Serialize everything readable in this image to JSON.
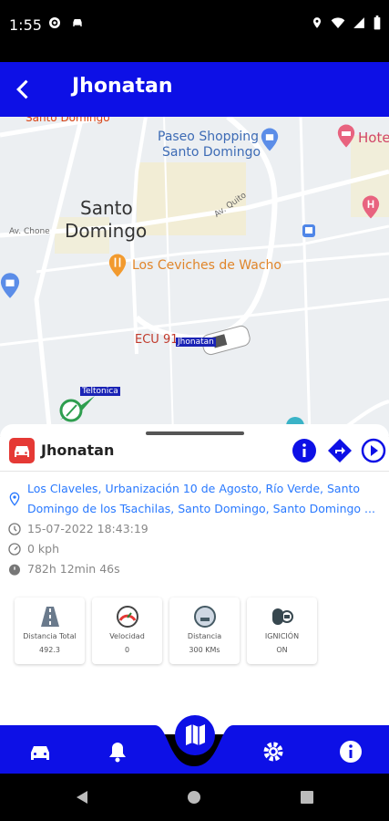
{
  "status_bar": {
    "time": "1:55"
  },
  "app_bar": {
    "title": "Jhonatan"
  },
  "map": {
    "labels": {
      "santo_domingo_top": "Santo Domingo",
      "paseo": "Paseo Shopping",
      "paseo2": "Santo Domingo",
      "hotel": "Hote",
      "santo": "Santo",
      "domingo": "Domingo",
      "ax_quito": "Av. Quito",
      "ax_chone": "Av. Chone",
      "ceviches": "Los Ceviches de Wacho",
      "ecu": "ECU 91",
      "vehicle_tag": "Jhonatan",
      "teltonica": "Teltonica"
    }
  },
  "sheet": {
    "vehicle_name": "Jhonatan",
    "address": "Los Claveles, Urbanización 10 de Agosto, Río Verde, Santo Domingo de los Tsachilas, Santo Domingo, Santo Domingo ...",
    "datetime": "15-07-2022 18:43:19",
    "speed": "0 kph",
    "duration": "782h 12min 46s",
    "cards": [
      {
        "label": "Distancia Total",
        "value": "492.3"
      },
      {
        "label": "Velocidad",
        "value": "0"
      },
      {
        "label": "Distancia",
        "value": "300 KMs"
      },
      {
        "label": "IGNICIÓN",
        "value": "ON"
      }
    ]
  },
  "colors": {
    "primary": "#0d10e6",
    "accent_red": "#e53935",
    "link": "#2979ff"
  }
}
